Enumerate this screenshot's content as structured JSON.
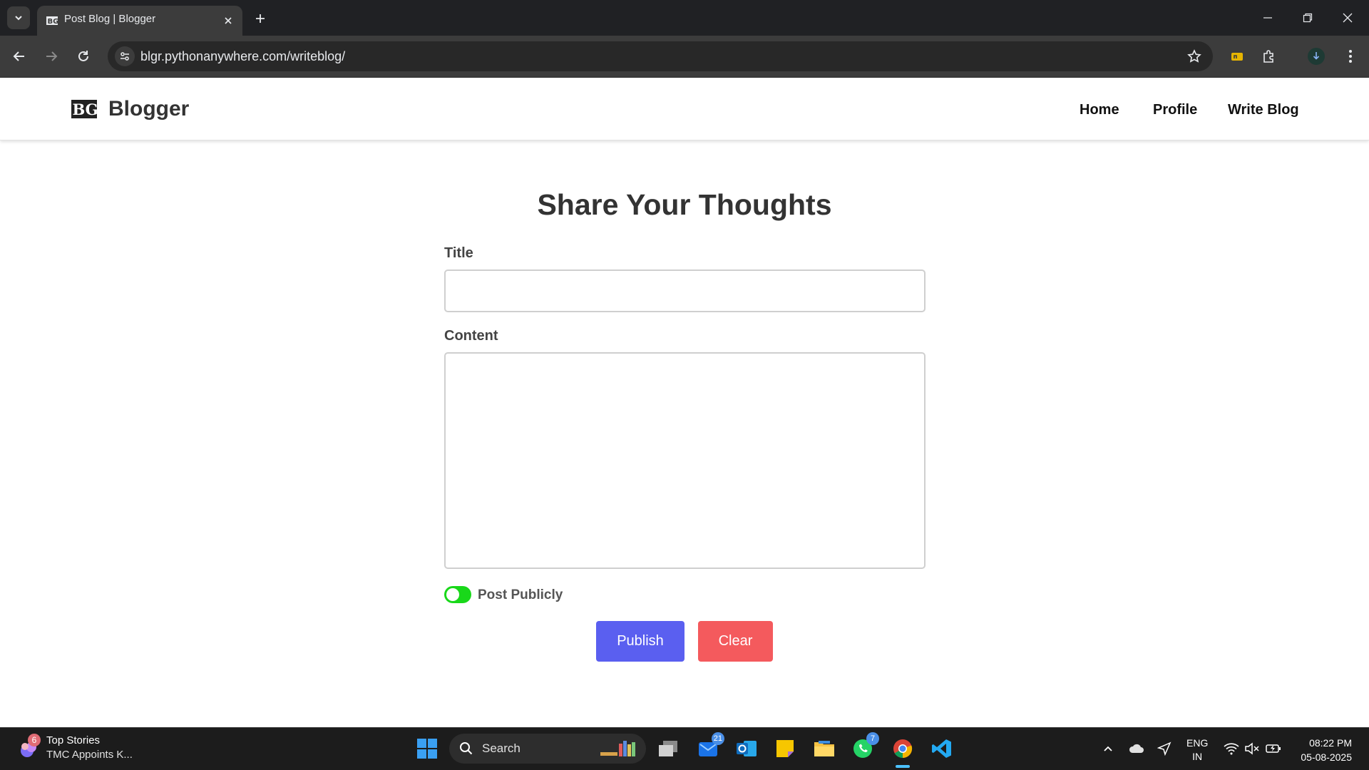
{
  "browser": {
    "tab_title": "Post Blog | Blogger",
    "url": "blgr.pythonanywhere.com/writeblog/"
  },
  "site": {
    "brand_name": "Blogger",
    "nav": [
      {
        "label": "Home"
      },
      {
        "label": "Profile"
      },
      {
        "label": "Write Blog"
      }
    ]
  },
  "form": {
    "heading": "Share Your Thoughts",
    "title_label": "Title",
    "title_value": "",
    "content_label": "Content",
    "content_value": "",
    "public_label": "Post Publicly",
    "public_enabled": true,
    "publish_label": "Publish",
    "clear_label": "Clear"
  },
  "colors": {
    "publish_button": "#5a5ff0",
    "clear_button": "#f45a5d",
    "toggle_on": "#19d81a"
  },
  "taskbar": {
    "news_badge": "6",
    "news_title": "Top Stories",
    "news_subtitle": "TMC Appoints K...",
    "search_label": "Search",
    "outlook_badge": "21",
    "whatsapp_badge": "7",
    "language_line1": "ENG",
    "language_line2": "IN",
    "time": "08:22 PM",
    "date": "05-08-2025"
  }
}
